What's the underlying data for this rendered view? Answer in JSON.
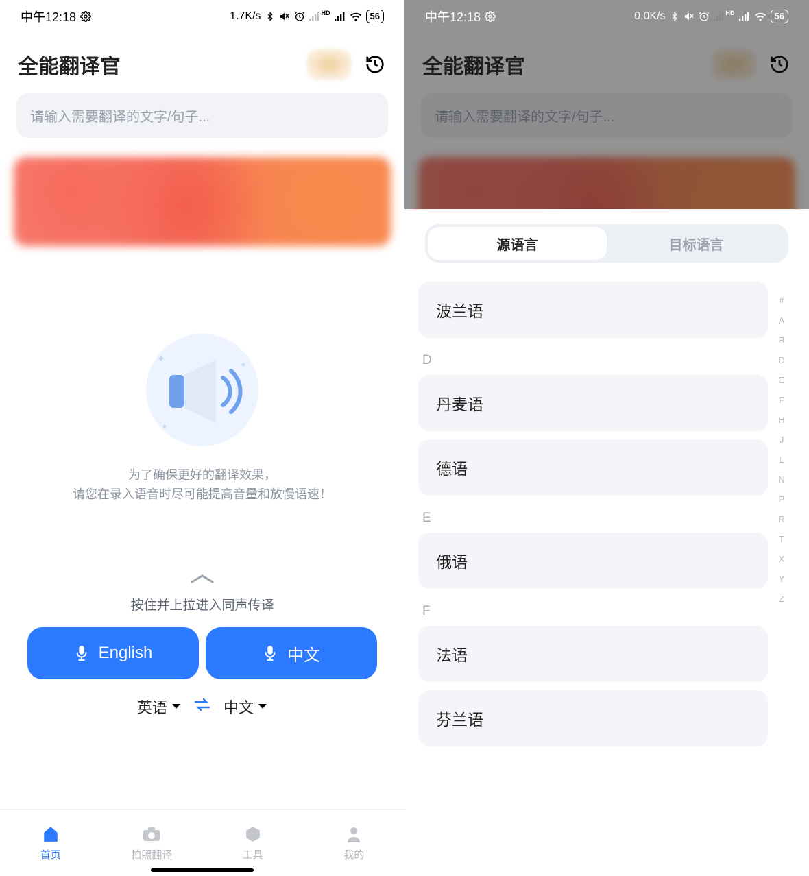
{
  "status": {
    "time": "中午12:18",
    "speed_left": "1.7K/s",
    "speed_right": "0.0K/s",
    "battery": "56"
  },
  "header": {
    "title": "全能翻译官"
  },
  "input": {
    "placeholder": "请输入需要翻译的文字/句子..."
  },
  "tips": {
    "line1": "为了确保更好的翻译效果，",
    "line2": "请您在录入语音时尽可能提高音量和放慢语速！"
  },
  "pull_hint": "按住并上拉进入同声传译",
  "mic": {
    "left": "English",
    "right": "中文"
  },
  "lang_pair": {
    "source": "英语",
    "target": "中文"
  },
  "nav": {
    "home": "首页",
    "photo": "拍照翻译",
    "tools": "工具",
    "mine": "我的"
  },
  "sheet": {
    "tab_source": "源语言",
    "tab_target": "目标语言",
    "groups": [
      {
        "letter": "",
        "items": [
          "波兰语"
        ]
      },
      {
        "letter": "D",
        "items": [
          "丹麦语",
          "德语"
        ]
      },
      {
        "letter": "E",
        "items": [
          "俄语"
        ]
      },
      {
        "letter": "F",
        "items": [
          "法语",
          "芬兰语"
        ]
      }
    ],
    "index": [
      "#",
      "A",
      "B",
      "D",
      "E",
      "F",
      "H",
      "J",
      "L",
      "N",
      "P",
      "R",
      "T",
      "X",
      "Y",
      "Z"
    ]
  }
}
